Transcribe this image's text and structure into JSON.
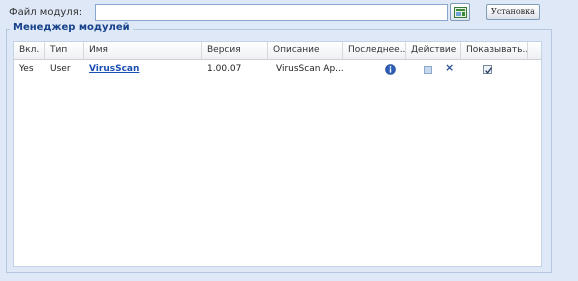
{
  "file_row": {
    "label": "Файл модуля:",
    "input_value": "",
    "install_label": "Установка"
  },
  "manager": {
    "legend": "Менеджер модулей",
    "columns": [
      "Вкл.",
      "Тип",
      "Имя",
      "Версия",
      "Описание",
      "Последнее...",
      "Действие",
      "Показывать..."
    ],
    "rows": [
      {
        "enabled": "Yes",
        "type": "User",
        "name": "VirusScan",
        "version": "1.00.07",
        "description": "VirusScan Ap...",
        "last_icon": "info-icon",
        "actions": [
          "edit-square-icon",
          "delete-x-icon"
        ],
        "show_checked": true
      }
    ]
  },
  "colors": {
    "background": "#dfe8f6",
    "legend_text": "#15428b",
    "link": "#1b4fb3"
  }
}
